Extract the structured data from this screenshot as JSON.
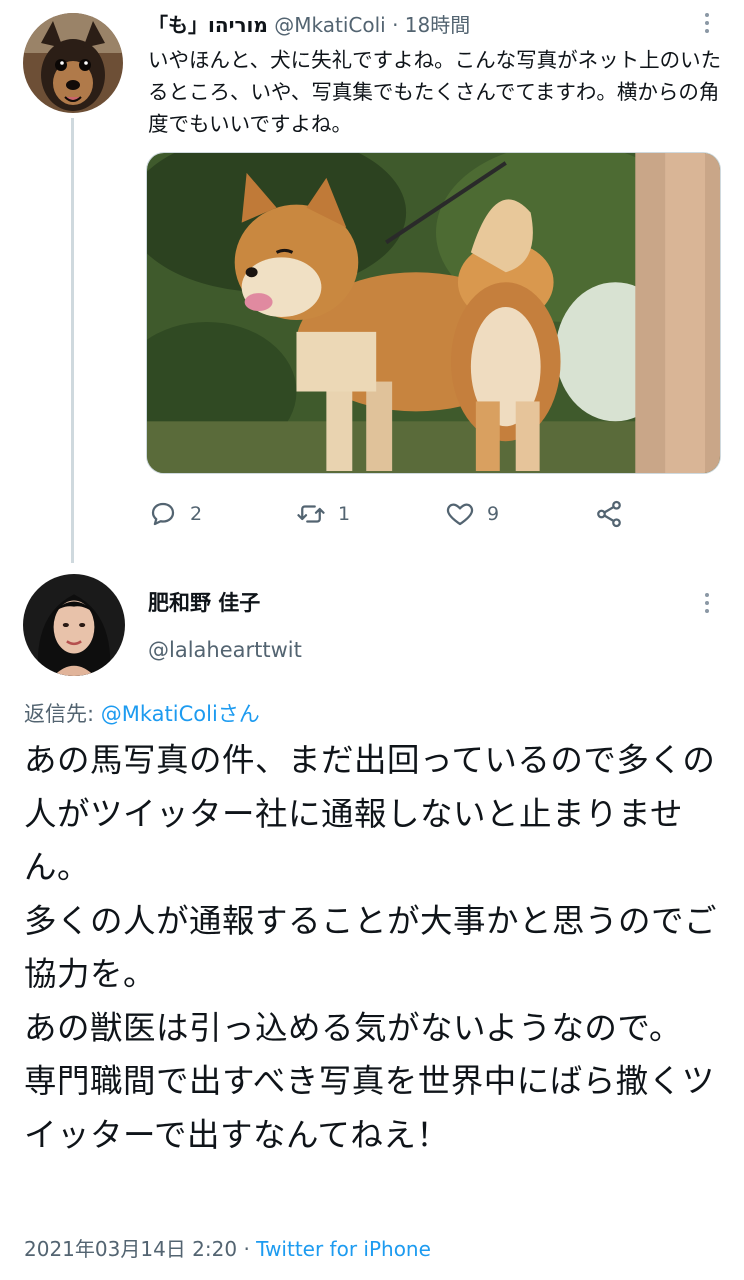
{
  "tweet1": {
    "display_name": "「も」מוריהו",
    "handle": "@MkatiColi",
    "separator": "·",
    "time": "18時間",
    "text": "いやほんと、犬に失礼ですよね。こんな写真がネット上のいたるところ、いや、写真集でもたくさんでてますわ。横からの角度でもいいですよね。",
    "media_description_icon": "shiba-inu-photo",
    "actions": {
      "reply_count": "2",
      "retweet_count": "1",
      "like_count": "9"
    }
  },
  "tweet2": {
    "display_name": "肥和野 佳子",
    "handle": "@lalaheartt​wit",
    "reply_prefix": "返信先: ",
    "reply_to": "@MkatiColiさん",
    "text": "あの馬写真の件、まだ出回っているので多くの人がツイッター社に通報しないと止まりません。\n多くの人が通報することが大事かと思うのでご協力を。\nあの獣医は引っ込める気がないようなので。\n専門職間で出すべき写真を世界中にばら撒くツイッターで出すなんてねえ！",
    "date": "2021年03月14日 2:20",
    "separator": "·",
    "source": "Twitter for iPhone"
  },
  "colors": {
    "accent": "#1d9bf0",
    "secondary_text": "#536471",
    "primary_text": "#0f1419",
    "thread_line": "#cfd9de"
  }
}
